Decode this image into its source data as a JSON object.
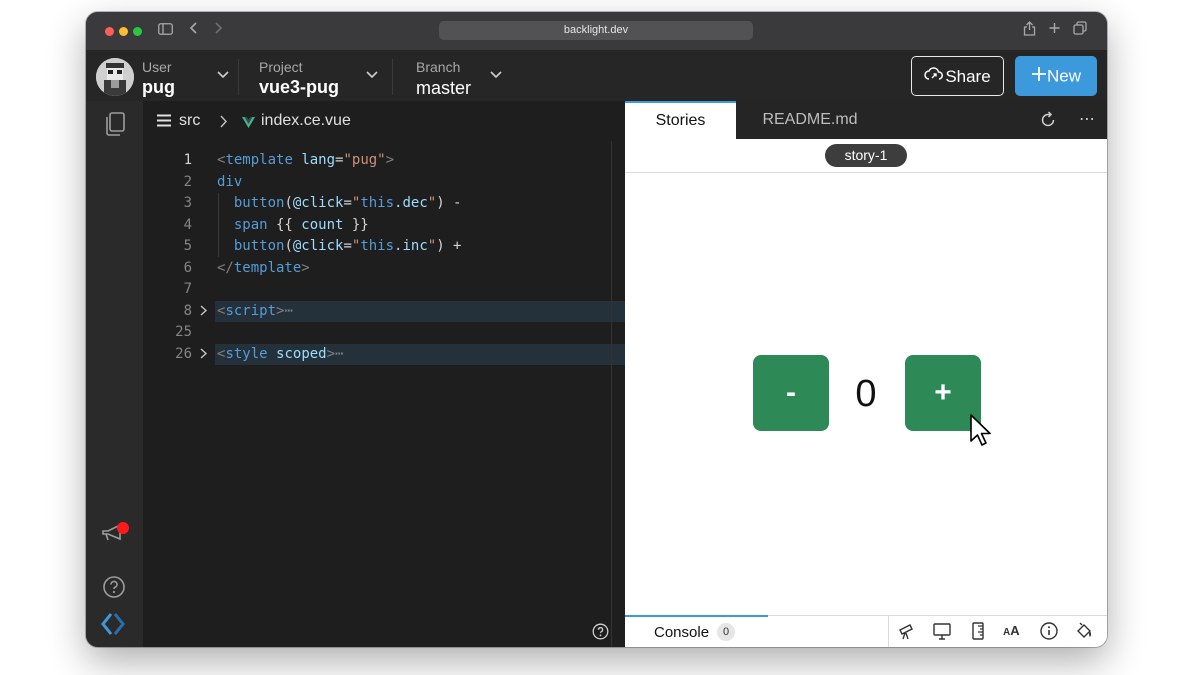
{
  "browser": {
    "url": "backlight.dev"
  },
  "header": {
    "user_label": "User",
    "user_value": "pug",
    "project_label": "Project",
    "project_value": "vue3-pug",
    "branch_label": "Branch",
    "branch_value": "master",
    "share_label": "Share",
    "new_label": "New"
  },
  "editor": {
    "breadcrumb_folder": "src",
    "breadcrumb_file": "index.ce.vue",
    "lines": [
      {
        "num": "1",
        "text": "<template lang=\"pug\">"
      },
      {
        "num": "2",
        "text": "div"
      },
      {
        "num": "3",
        "text": "  button(@click=\"this.dec\") -"
      },
      {
        "num": "4",
        "text": "  span {{ count }}"
      },
      {
        "num": "5",
        "text": "  button(@click=\"this.inc\") +"
      },
      {
        "num": "6",
        "text": "</template>"
      },
      {
        "num": "7",
        "text": ""
      },
      {
        "num": "8",
        "text": "<script>"
      },
      {
        "num": "25",
        "text": ""
      },
      {
        "num": "26",
        "text": "<style scoped>"
      }
    ],
    "fold_ellipsis": "⋯"
  },
  "preview": {
    "tabs": [
      "Stories",
      "README.md"
    ],
    "story": "story-1",
    "decrement_label": "-",
    "count": "0",
    "increment_label": "+",
    "console_label": "Console",
    "console_count": "0"
  },
  "colors": {
    "accent": "#3c99dc",
    "counter_button": "#2d8a57",
    "notification_dot": "#ff1a1a"
  }
}
